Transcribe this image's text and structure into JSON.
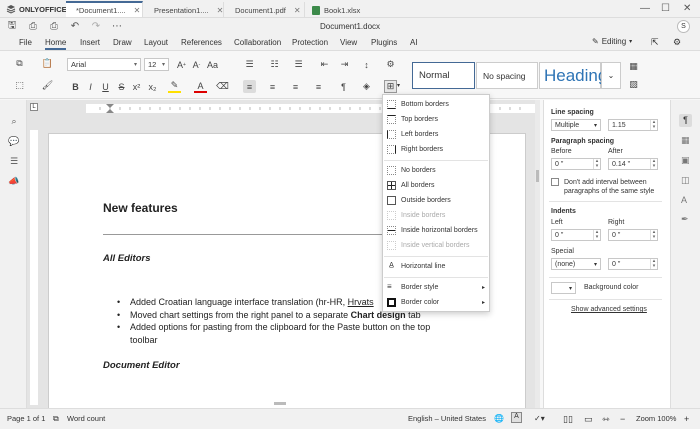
{
  "app": {
    "brand": "ONLYOFFICE",
    "doc_title": "Document1.docx",
    "tabs": [
      {
        "label": "*Document1....",
        "color": "#446995"
      },
      {
        "label": "Presentation1....",
        "color": "#b54a34"
      },
      {
        "label": "Document1.pdf",
        "color": "#aa3434"
      },
      {
        "label": "Book1.xlsx",
        "color": "#3c8a4a"
      }
    ],
    "user_initial": "S"
  },
  "menu": {
    "items": [
      "File",
      "Home",
      "Insert",
      "Draw",
      "Layout",
      "References",
      "Collaboration",
      "Protection",
      "View",
      "Plugins",
      "AI"
    ],
    "active": "Home",
    "editing_label": "Editing"
  },
  "toolbar": {
    "font_name": "Arial",
    "font_size": "12",
    "styles": [
      "Normal",
      "No spacing",
      "Heading"
    ]
  },
  "document": {
    "heading": "New features",
    "section1": "All Editors",
    "bullets": [
      {
        "text": "Added Croatian language interface translation (hr-HR, ",
        "link": "Hrvats"
      },
      {
        "text": "Moved chart settings from the right panel to a separate ",
        "bold": "Chart design",
        "tail": " tab"
      },
      {
        "text": "Added options for pasting from the clipboard for the Paste button on the top toolbar"
      }
    ],
    "section2": "Document Editor"
  },
  "borders_menu": {
    "items": [
      {
        "label": "Bottom borders",
        "disabled": false
      },
      {
        "label": "Top borders",
        "disabled": false
      },
      {
        "label": "Left borders",
        "disabled": false
      },
      {
        "label": "Right borders",
        "disabled": false
      },
      {
        "label": "No borders",
        "disabled": false
      },
      {
        "label": "All borders",
        "disabled": false
      },
      {
        "label": "Outside borders",
        "disabled": false
      },
      {
        "label": "Inside borders",
        "disabled": true
      },
      {
        "label": "Inside horizontal borders",
        "disabled": false
      },
      {
        "label": "Inside vertical borders",
        "disabled": true
      },
      {
        "label": "Horizontal line",
        "disabled": false
      },
      {
        "label": "Border style",
        "disabled": false
      },
      {
        "label": "Border color",
        "disabled": false
      }
    ]
  },
  "right_panel": {
    "line_spacing_title": "Line spacing",
    "line_spacing_type": "Multiple",
    "line_spacing_value": "1.15",
    "paragraph_spacing_title": "Paragraph spacing",
    "before_label": "Before",
    "after_label": "After",
    "before_value": "0 \"",
    "after_value": "0.14 \"",
    "dont_add_interval": "Don't add interval between paragraphs of the same style",
    "indents_title": "Indents",
    "left_label": "Left",
    "right_label": "Right",
    "left_value": "0 \"",
    "right_value": "0 \"",
    "special_label": "Special",
    "special_value": "(none)",
    "special_size": "0 \"",
    "bg_color_label": "Background color",
    "advanced_link": "Show advanced settings"
  },
  "status": {
    "page": "Page 1 of 1",
    "word_count": "Word count",
    "language": "English – United States",
    "zoom": "Zoom 100%"
  }
}
